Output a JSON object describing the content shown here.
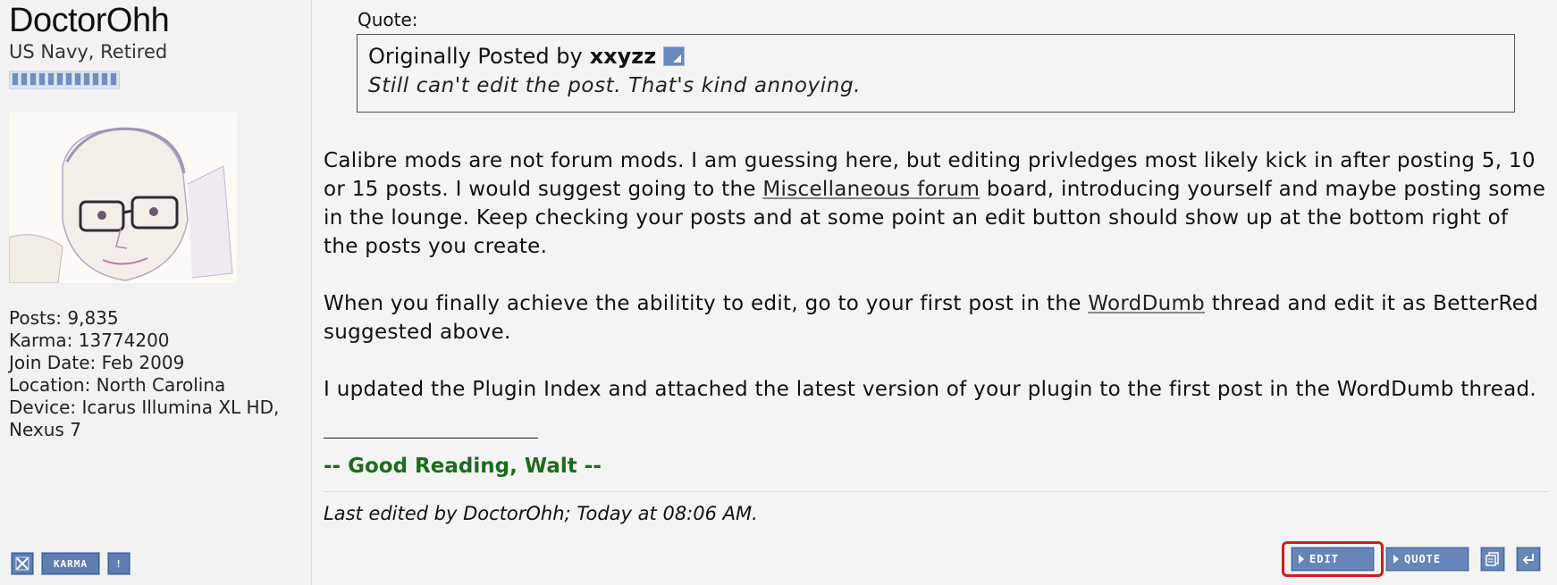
{
  "user": {
    "name": "DoctorOhh",
    "title": "US Navy, Retired",
    "stats": [
      "Posts: 9,835",
      "Karma: 13774200",
      "Join Date: Feb 2009",
      "Location: North Carolina",
      "Device: Icarus Illumina XL HD,",
      "Nexus 7"
    ],
    "reputation_pips": 12
  },
  "user_buttons": {
    "karma_label": "KARMA",
    "report_label": "!"
  },
  "quote": {
    "label": "Quote:",
    "originally_posted_by": "Originally Posted by",
    "author": "xxyzz",
    "text": "Still can't edit the post. That's kind annoying."
  },
  "post": {
    "p1_before": "Calibre mods are not forum mods. I am guessing here, but editing privledges most likely kick in after posting 5, 10 or 15 posts. I would suggest going to the ",
    "p1_link": "Miscellaneous forum",
    "p1_after": " board, introducing yourself and maybe posting some in the lounge. Keep checking your posts and at some point an edit button should show up at the bottom right of the posts you create.",
    "p2_before": "When you finally achieve the abilitity to edit, go to your first post in the ",
    "p2_link": "WordDumb",
    "p2_after": " thread and edit it as BetterRed suggested above.",
    "p3": "I updated the Plugin Index and attached the latest version of your plugin to the first post in the WordDumb thread."
  },
  "signature": "-- Good Reading, Walt --",
  "edit_note": {
    "prefix": "Last edited by DoctorOhh;",
    "time": "Today at 08:06 AM."
  },
  "actions": {
    "edit_label": "EDIT",
    "quote_label": "QUOTE"
  },
  "colors": {
    "button_blue": "#6785b8",
    "signature_green": "#1e6b1e",
    "highlight_red": "#d61a1a"
  }
}
